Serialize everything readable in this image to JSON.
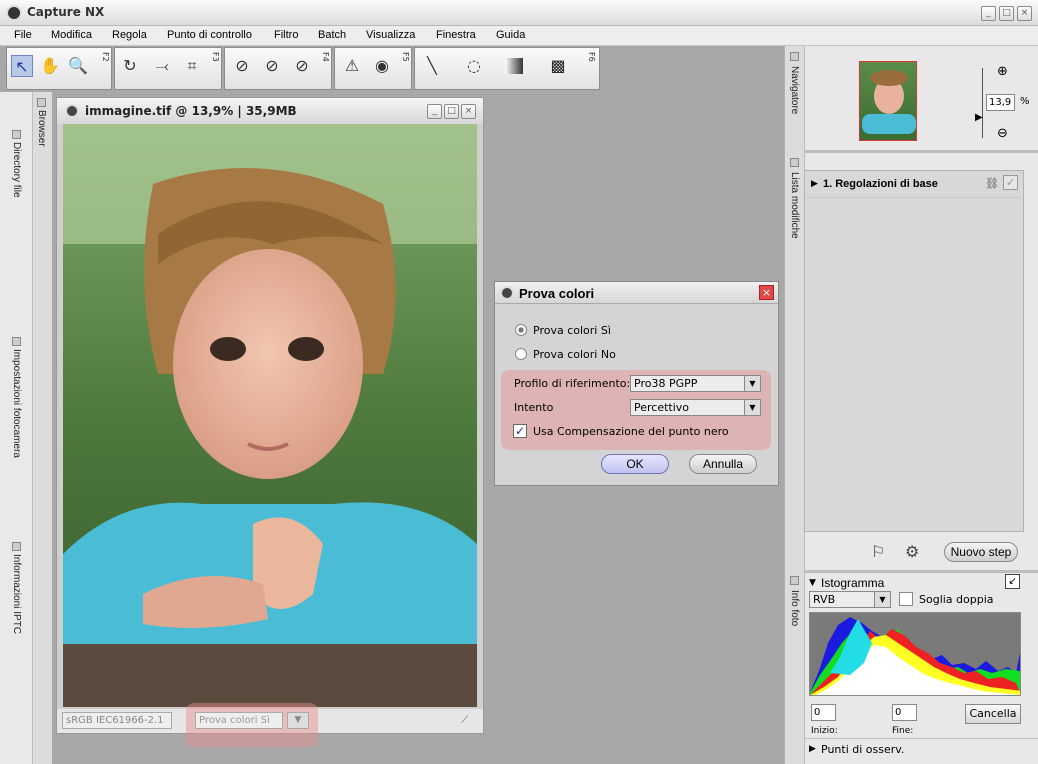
{
  "app": {
    "title": "Capture NX"
  },
  "menu": [
    "File",
    "Modifica",
    "Regola",
    "Punto di controllo",
    "Filtro",
    "Batch",
    "Visualizza",
    "Finestra",
    "Guida"
  ],
  "toolbar": {
    "fkeys": [
      "F2",
      "F3",
      "F4",
      "F5",
      "F6"
    ]
  },
  "left_tabs": {
    "browser": "Browser",
    "directory": "Directory file",
    "impostazioni": "Impostazioni fotocamera",
    "iptc": "Informazioni IPTC"
  },
  "document": {
    "title": "immagine.tif @ 13,9% | 35,9MB",
    "profile": "sRGB IEC61966-2.1",
    "proof_status": "Prova colori Sì"
  },
  "dialog": {
    "title": "Prova colori",
    "radio_on": "Prova colori Sì",
    "radio_off": "Prova colori No",
    "profile_label": "Profilo di riferimento:",
    "profile_value": "Pro38 PGPP",
    "intent_label": "Intento",
    "intent_value": "Percettivo",
    "checkbox_label": "Usa Compensazione del punto nero",
    "ok": "OK",
    "cancel": "Annulla"
  },
  "navigator": {
    "tab": "Navigatore",
    "zoom": "13,9",
    "unit": "%"
  },
  "edit_list": {
    "tab": "Lista modifiche",
    "step": "1. Regolazioni di base",
    "new_step": "Nuovo step"
  },
  "info": {
    "tab": "Info foto",
    "histogram": "Istogramma",
    "channel": "RVB",
    "double": "Soglia doppia",
    "start_value": "0",
    "end_value": "0",
    "start_label": "Inizio:",
    "end_label": "Fine:",
    "cancel": "Cancella",
    "watch_points": "Punti di osserv."
  },
  "colors": {
    "accent": "#3a5fa8",
    "highlight": "#eb8c8c"
  }
}
